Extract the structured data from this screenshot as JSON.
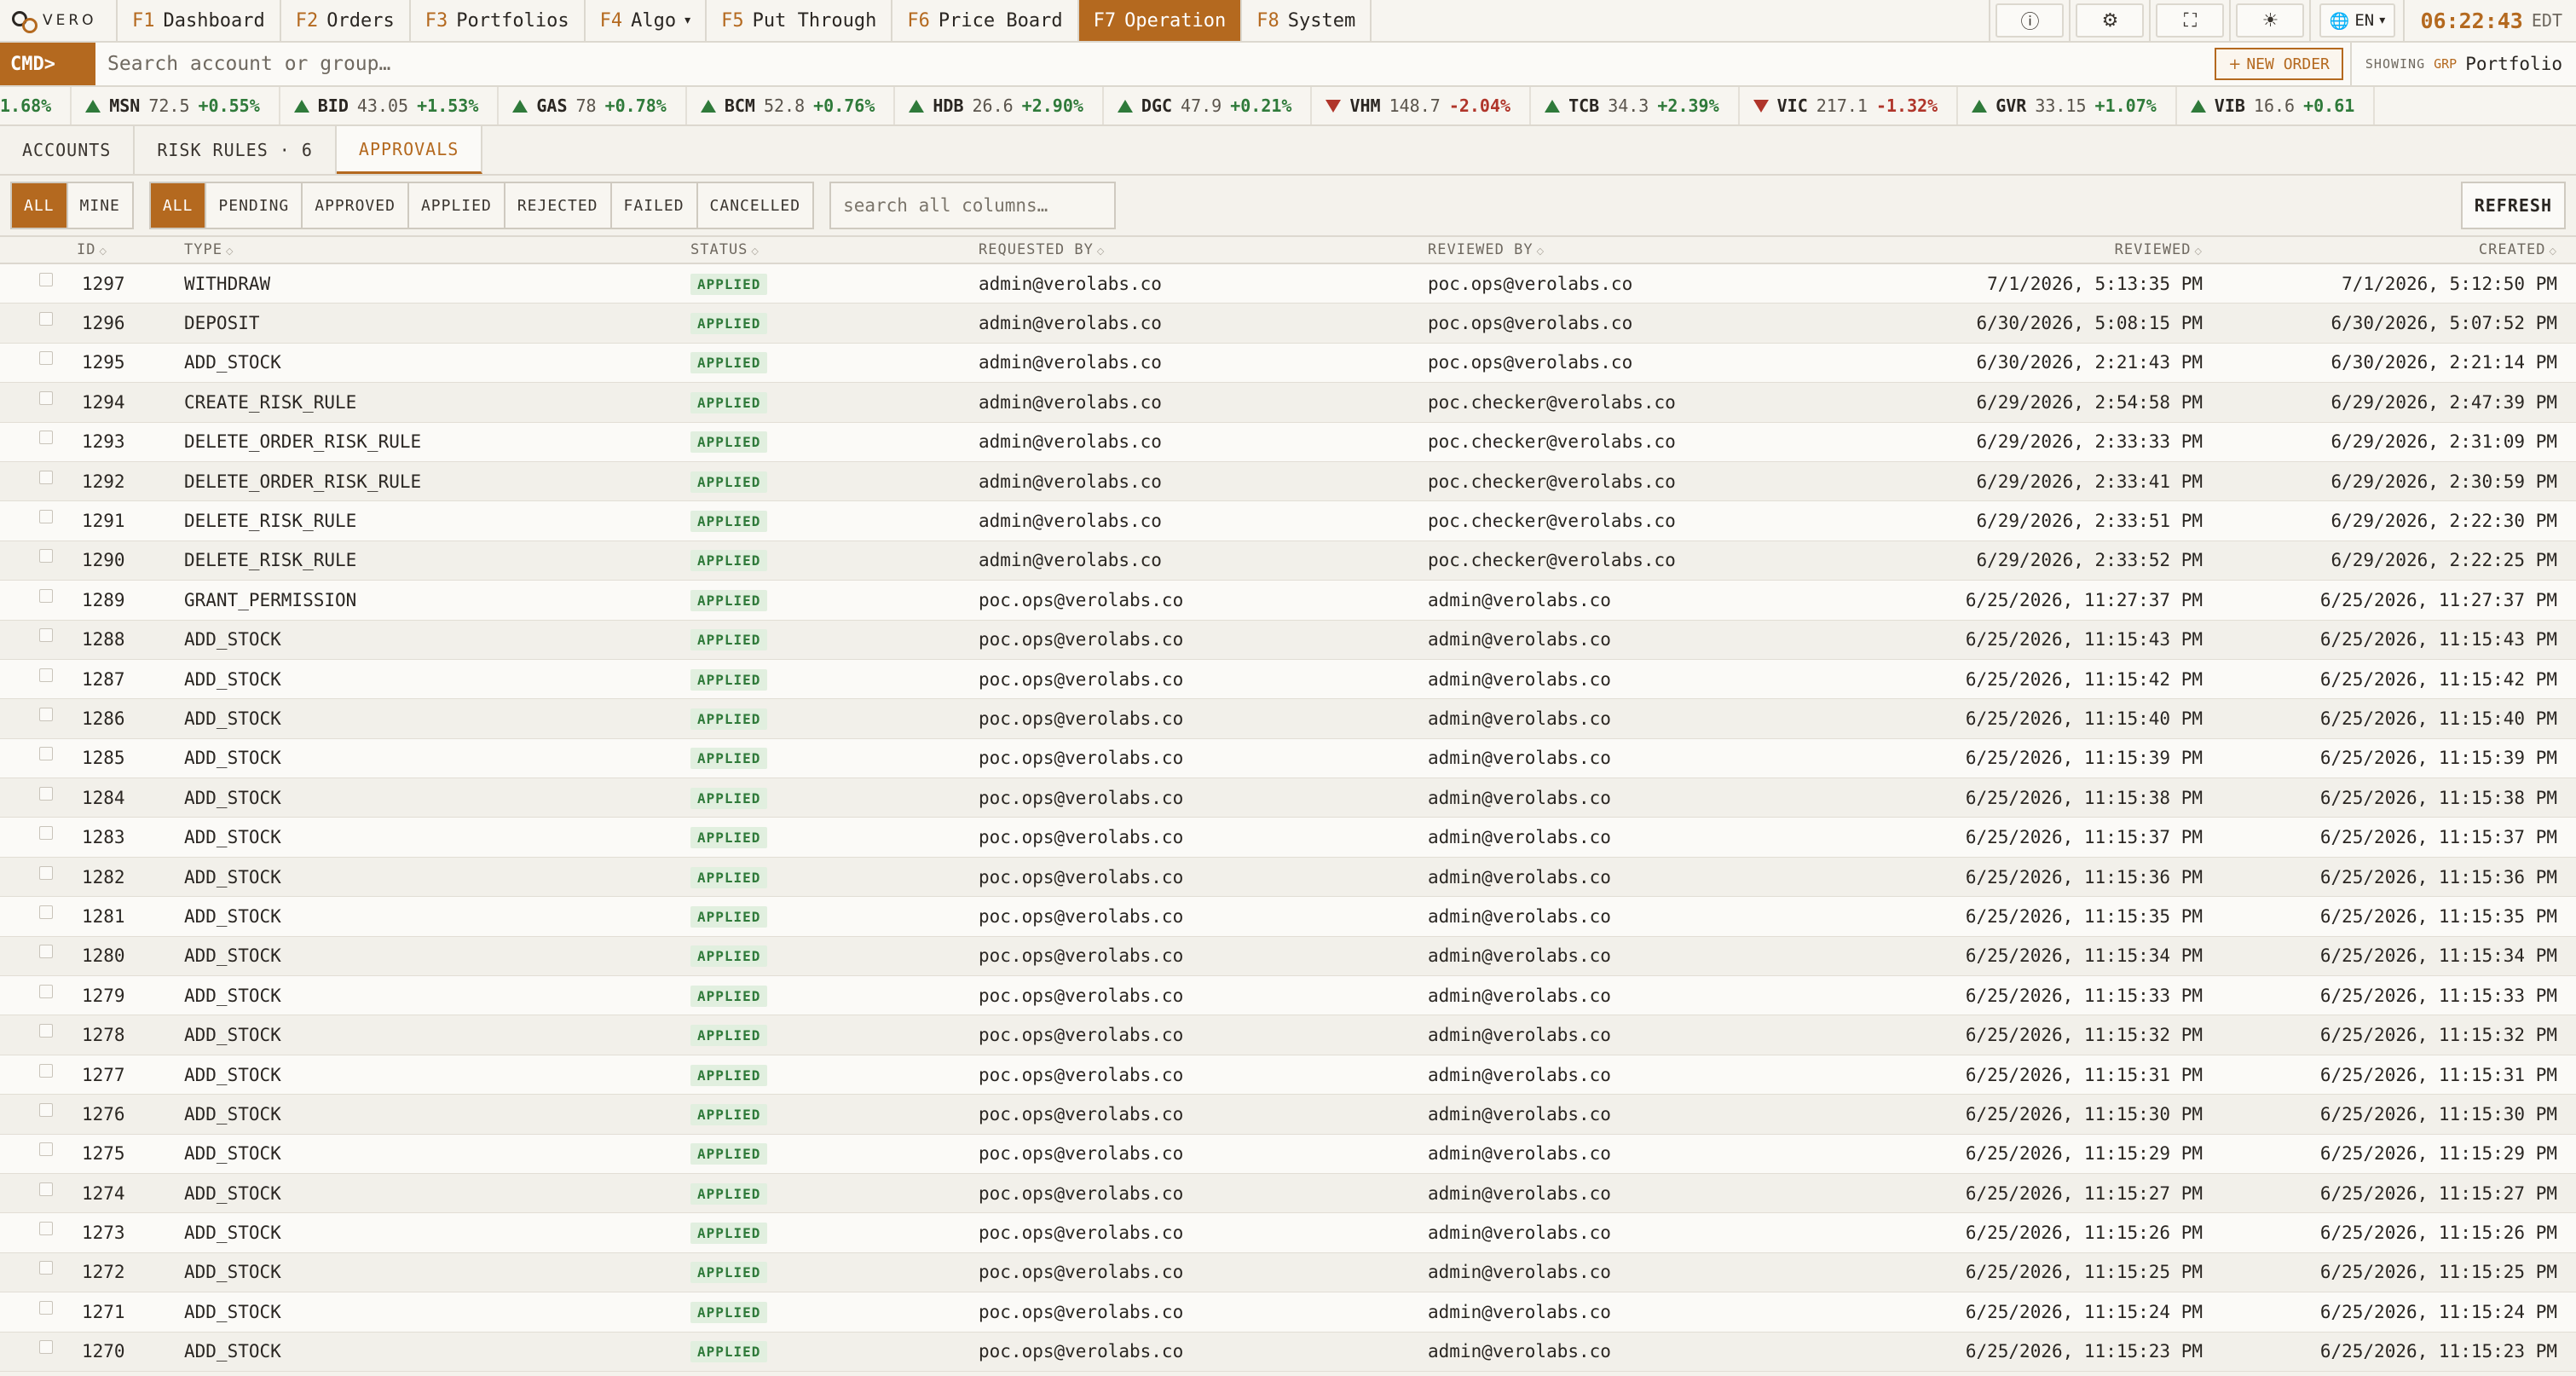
{
  "brand": {
    "name": "VERO"
  },
  "nav": {
    "tabs": [
      {
        "key": "F1",
        "label": "Dashboard",
        "active": false
      },
      {
        "key": "F2",
        "label": "Orders",
        "active": false
      },
      {
        "key": "F3",
        "label": "Portfolios",
        "active": false
      },
      {
        "key": "F4",
        "label": "Algo",
        "active": false,
        "dropdown": true
      },
      {
        "key": "F5",
        "label": "Put Through",
        "active": false
      },
      {
        "key": "F6",
        "label": "Price Board",
        "active": false
      },
      {
        "key": "F7",
        "label": "Operation",
        "active": true
      },
      {
        "key": "F8",
        "label": "System",
        "active": false
      }
    ],
    "icons": [
      "help-icon",
      "gear-icon",
      "fullscreen-icon",
      "theme-icon"
    ],
    "language": "EN",
    "clock": {
      "time": "06:22:43",
      "zone": "EDT"
    }
  },
  "cmdbar": {
    "label": "CMD>",
    "placeholder": "Search account or group…",
    "new_order": "NEW ORDER",
    "showing_label": "SHOWING",
    "showing_type": "GRP",
    "showing_value": "Portfolio"
  },
  "ticker": [
    {
      "sym": "",
      "price": "",
      "change": "1.68%",
      "dir": "up",
      "partial": true
    },
    {
      "sym": "MSN",
      "price": "72.5",
      "change": "+0.55%",
      "dir": "up"
    },
    {
      "sym": "BID",
      "price": "43.05",
      "change": "+1.53%",
      "dir": "up"
    },
    {
      "sym": "GAS",
      "price": "78",
      "change": "+0.78%",
      "dir": "up"
    },
    {
      "sym": "BCM",
      "price": "52.8",
      "change": "+0.76%",
      "dir": "up"
    },
    {
      "sym": "HDB",
      "price": "26.6",
      "change": "+2.90%",
      "dir": "up"
    },
    {
      "sym": "DGC",
      "price": "47.9",
      "change": "+0.21%",
      "dir": "up"
    },
    {
      "sym": "VHM",
      "price": "148.7",
      "change": "-2.04%",
      "dir": "down"
    },
    {
      "sym": "TCB",
      "price": "34.3",
      "change": "+2.39%",
      "dir": "up"
    },
    {
      "sym": "VIC",
      "price": "217.1",
      "change": "-1.32%",
      "dir": "down"
    },
    {
      "sym": "GVR",
      "price": "33.15",
      "change": "+1.07%",
      "dir": "up"
    },
    {
      "sym": "VIB",
      "price": "16.6",
      "change": "+0.61",
      "dir": "up"
    }
  ],
  "subtabs": [
    {
      "label": "ACCOUNTS",
      "active": false
    },
    {
      "label": "RISK RULES · 6",
      "active": false
    },
    {
      "label": "APPROVALS",
      "active": true
    }
  ],
  "filters": {
    "scope": [
      {
        "label": "ALL",
        "on": true
      },
      {
        "label": "MINE",
        "on": false
      }
    ],
    "status": [
      {
        "label": "ALL",
        "on": true
      },
      {
        "label": "PENDING",
        "on": false
      },
      {
        "label": "APPROVED",
        "on": false
      },
      {
        "label": "APPLIED",
        "on": false
      },
      {
        "label": "REJECTED",
        "on": false
      },
      {
        "label": "FAILED",
        "on": false
      },
      {
        "label": "CANCELLED",
        "on": false
      }
    ],
    "search_placeholder": "search all columns…",
    "refresh": "REFRESH"
  },
  "table": {
    "columns": {
      "id": "ID",
      "type": "TYPE",
      "status": "STATUS",
      "requested_by": "REQUESTED BY",
      "reviewed_by": "REVIEWED BY",
      "reviewed": "REVIEWED",
      "created": "CREATED"
    },
    "rows": [
      {
        "id": "1297",
        "type": "WITHDRAW",
        "status": "APPLIED",
        "requested_by": "admin@verolabs.co",
        "reviewed_by": "poc.ops@verolabs.co",
        "reviewed": "7/1/2026, 5:13:35 PM",
        "created": "7/1/2026, 5:12:50 PM"
      },
      {
        "id": "1296",
        "type": "DEPOSIT",
        "status": "APPLIED",
        "requested_by": "admin@verolabs.co",
        "reviewed_by": "poc.ops@verolabs.co",
        "reviewed": "6/30/2026, 5:08:15 PM",
        "created": "6/30/2026, 5:07:52 PM"
      },
      {
        "id": "1295",
        "type": "ADD_STOCK",
        "status": "APPLIED",
        "requested_by": "admin@verolabs.co",
        "reviewed_by": "poc.ops@verolabs.co",
        "reviewed": "6/30/2026, 2:21:43 PM",
        "created": "6/30/2026, 2:21:14 PM"
      },
      {
        "id": "1294",
        "type": "CREATE_RISK_RULE",
        "status": "APPLIED",
        "requested_by": "admin@verolabs.co",
        "reviewed_by": "poc.checker@verolabs.co",
        "reviewed": "6/29/2026, 2:54:58 PM",
        "created": "6/29/2026, 2:47:39 PM"
      },
      {
        "id": "1293",
        "type": "DELETE_ORDER_RISK_RULE",
        "status": "APPLIED",
        "requested_by": "admin@verolabs.co",
        "reviewed_by": "poc.checker@verolabs.co",
        "reviewed": "6/29/2026, 2:33:33 PM",
        "created": "6/29/2026, 2:31:09 PM"
      },
      {
        "id": "1292",
        "type": "DELETE_ORDER_RISK_RULE",
        "status": "APPLIED",
        "requested_by": "admin@verolabs.co",
        "reviewed_by": "poc.checker@verolabs.co",
        "reviewed": "6/29/2026, 2:33:41 PM",
        "created": "6/29/2026, 2:30:59 PM"
      },
      {
        "id": "1291",
        "type": "DELETE_RISK_RULE",
        "status": "APPLIED",
        "requested_by": "admin@verolabs.co",
        "reviewed_by": "poc.checker@verolabs.co",
        "reviewed": "6/29/2026, 2:33:51 PM",
        "created": "6/29/2026, 2:22:30 PM"
      },
      {
        "id": "1290",
        "type": "DELETE_RISK_RULE",
        "status": "APPLIED",
        "requested_by": "admin@verolabs.co",
        "reviewed_by": "poc.checker@verolabs.co",
        "reviewed": "6/29/2026, 2:33:52 PM",
        "created": "6/29/2026, 2:22:25 PM"
      },
      {
        "id": "1289",
        "type": "GRANT_PERMISSION",
        "status": "APPLIED",
        "requested_by": "poc.ops@verolabs.co",
        "reviewed_by": "admin@verolabs.co",
        "reviewed": "6/25/2026, 11:27:37 PM",
        "created": "6/25/2026, 11:27:37 PM"
      },
      {
        "id": "1288",
        "type": "ADD_STOCK",
        "status": "APPLIED",
        "requested_by": "poc.ops@verolabs.co",
        "reviewed_by": "admin@verolabs.co",
        "reviewed": "6/25/2026, 11:15:43 PM",
        "created": "6/25/2026, 11:15:43 PM"
      },
      {
        "id": "1287",
        "type": "ADD_STOCK",
        "status": "APPLIED",
        "requested_by": "poc.ops@verolabs.co",
        "reviewed_by": "admin@verolabs.co",
        "reviewed": "6/25/2026, 11:15:42 PM",
        "created": "6/25/2026, 11:15:42 PM"
      },
      {
        "id": "1286",
        "type": "ADD_STOCK",
        "status": "APPLIED",
        "requested_by": "poc.ops@verolabs.co",
        "reviewed_by": "admin@verolabs.co",
        "reviewed": "6/25/2026, 11:15:40 PM",
        "created": "6/25/2026, 11:15:40 PM"
      },
      {
        "id": "1285",
        "type": "ADD_STOCK",
        "status": "APPLIED",
        "requested_by": "poc.ops@verolabs.co",
        "reviewed_by": "admin@verolabs.co",
        "reviewed": "6/25/2026, 11:15:39 PM",
        "created": "6/25/2026, 11:15:39 PM"
      },
      {
        "id": "1284",
        "type": "ADD_STOCK",
        "status": "APPLIED",
        "requested_by": "poc.ops@verolabs.co",
        "reviewed_by": "admin@verolabs.co",
        "reviewed": "6/25/2026, 11:15:38 PM",
        "created": "6/25/2026, 11:15:38 PM"
      },
      {
        "id": "1283",
        "type": "ADD_STOCK",
        "status": "APPLIED",
        "requested_by": "poc.ops@verolabs.co",
        "reviewed_by": "admin@verolabs.co",
        "reviewed": "6/25/2026, 11:15:37 PM",
        "created": "6/25/2026, 11:15:37 PM"
      },
      {
        "id": "1282",
        "type": "ADD_STOCK",
        "status": "APPLIED",
        "requested_by": "poc.ops@verolabs.co",
        "reviewed_by": "admin@verolabs.co",
        "reviewed": "6/25/2026, 11:15:36 PM",
        "created": "6/25/2026, 11:15:36 PM"
      },
      {
        "id": "1281",
        "type": "ADD_STOCK",
        "status": "APPLIED",
        "requested_by": "poc.ops@verolabs.co",
        "reviewed_by": "admin@verolabs.co",
        "reviewed": "6/25/2026, 11:15:35 PM",
        "created": "6/25/2026, 11:15:35 PM"
      },
      {
        "id": "1280",
        "type": "ADD_STOCK",
        "status": "APPLIED",
        "requested_by": "poc.ops@verolabs.co",
        "reviewed_by": "admin@verolabs.co",
        "reviewed": "6/25/2026, 11:15:34 PM",
        "created": "6/25/2026, 11:15:34 PM"
      },
      {
        "id": "1279",
        "type": "ADD_STOCK",
        "status": "APPLIED",
        "requested_by": "poc.ops@verolabs.co",
        "reviewed_by": "admin@verolabs.co",
        "reviewed": "6/25/2026, 11:15:33 PM",
        "created": "6/25/2026, 11:15:33 PM"
      },
      {
        "id": "1278",
        "type": "ADD_STOCK",
        "status": "APPLIED",
        "requested_by": "poc.ops@verolabs.co",
        "reviewed_by": "admin@verolabs.co",
        "reviewed": "6/25/2026, 11:15:32 PM",
        "created": "6/25/2026, 11:15:32 PM"
      },
      {
        "id": "1277",
        "type": "ADD_STOCK",
        "status": "APPLIED",
        "requested_by": "poc.ops@verolabs.co",
        "reviewed_by": "admin@verolabs.co",
        "reviewed": "6/25/2026, 11:15:31 PM",
        "created": "6/25/2026, 11:15:31 PM"
      },
      {
        "id": "1276",
        "type": "ADD_STOCK",
        "status": "APPLIED",
        "requested_by": "poc.ops@verolabs.co",
        "reviewed_by": "admin@verolabs.co",
        "reviewed": "6/25/2026, 11:15:30 PM",
        "created": "6/25/2026, 11:15:30 PM"
      },
      {
        "id": "1275",
        "type": "ADD_STOCK",
        "status": "APPLIED",
        "requested_by": "poc.ops@verolabs.co",
        "reviewed_by": "admin@verolabs.co",
        "reviewed": "6/25/2026, 11:15:29 PM",
        "created": "6/25/2026, 11:15:29 PM"
      },
      {
        "id": "1274",
        "type": "ADD_STOCK",
        "status": "APPLIED",
        "requested_by": "poc.ops@verolabs.co",
        "reviewed_by": "admin@verolabs.co",
        "reviewed": "6/25/2026, 11:15:27 PM",
        "created": "6/25/2026, 11:15:27 PM"
      },
      {
        "id": "1273",
        "type": "ADD_STOCK",
        "status": "APPLIED",
        "requested_by": "poc.ops@verolabs.co",
        "reviewed_by": "admin@verolabs.co",
        "reviewed": "6/25/2026, 11:15:26 PM",
        "created": "6/25/2026, 11:15:26 PM"
      },
      {
        "id": "1272",
        "type": "ADD_STOCK",
        "status": "APPLIED",
        "requested_by": "poc.ops@verolabs.co",
        "reviewed_by": "admin@verolabs.co",
        "reviewed": "6/25/2026, 11:15:25 PM",
        "created": "6/25/2026, 11:15:25 PM"
      },
      {
        "id": "1271",
        "type": "ADD_STOCK",
        "status": "APPLIED",
        "requested_by": "poc.ops@verolabs.co",
        "reviewed_by": "admin@verolabs.co",
        "reviewed": "6/25/2026, 11:15:24 PM",
        "created": "6/25/2026, 11:15:24 PM"
      },
      {
        "id": "1270",
        "type": "ADD_STOCK",
        "status": "APPLIED",
        "requested_by": "poc.ops@verolabs.co",
        "reviewed_by": "admin@verolabs.co",
        "reviewed": "6/25/2026, 11:15:23 PM",
        "created": "6/25/2026, 11:15:23 PM"
      }
    ]
  }
}
